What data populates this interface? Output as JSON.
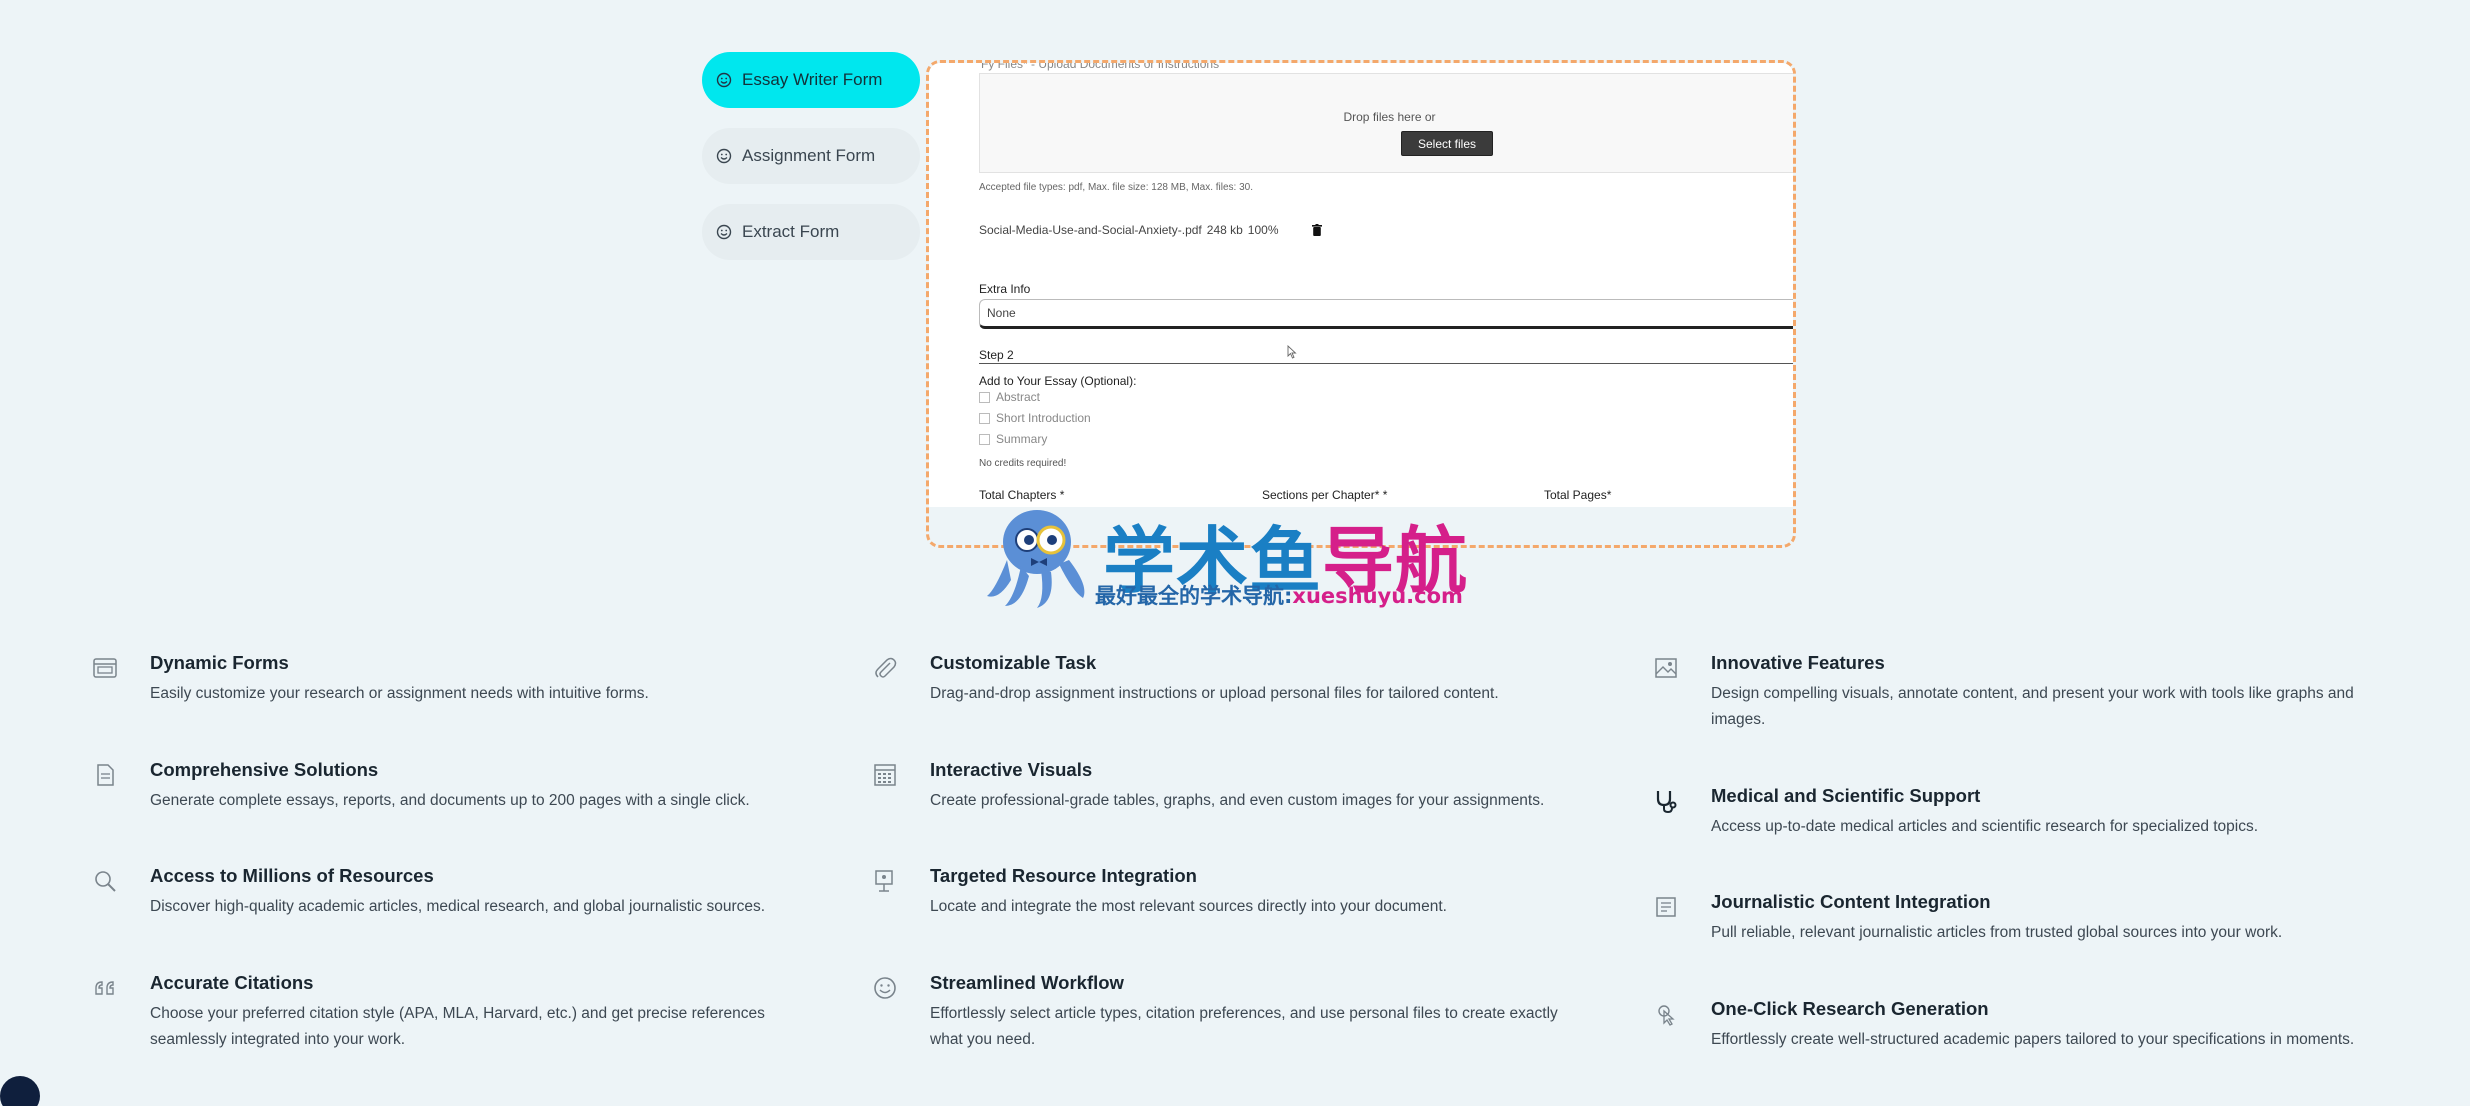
{
  "tabs": [
    {
      "label": "Essay Writer Form",
      "active": true
    },
    {
      "label": "Assignment Form",
      "active": false
    },
    {
      "label": "Extract Form",
      "active": false
    }
  ],
  "form": {
    "cut_label": "Fy Files* - Upload Documents or Instructions",
    "drop_text": "Drop files here or",
    "select_button": "Select files",
    "accepted": "Accepted file types: pdf, Max. file size: 128 MB, Max. files: 30.",
    "file": {
      "name": "Social-Media-Use-and-Social-Anxiety-.pdf",
      "size": "248 kb",
      "progress": "100%"
    },
    "extra_label": "Extra Info",
    "extra_value": "None",
    "step2": "Step 2",
    "add_label": "Add to Your Essay (Optional):",
    "options": [
      "Abstract",
      "Short Introduction",
      "Summary"
    ],
    "no_credits": "No credits required!",
    "total_chapters": "Total Chapters *",
    "sections_per_chapter": "Sections per Chapter* *",
    "total_pages": "Total Pages*"
  },
  "watermark": {
    "title_part1": "学术鱼",
    "title_part2": "导航",
    "sub_part1": "最好最全的学术导航:",
    "sub_part2": "xueshuyu.com"
  },
  "features": [
    {
      "icon": "form-icon",
      "title": "Dynamic Forms",
      "desc": "Easily customize your research or assignment needs with intuitive forms."
    },
    {
      "icon": "paperclip-icon",
      "title": "Customizable Task",
      "desc": "Drag-and-drop assignment instructions or upload personal files for tailored content."
    },
    {
      "icon": "image-icon",
      "title": "Innovative Features",
      "desc": "Design compelling visuals, annotate content, and present your work with tools like graphs and images."
    },
    {
      "icon": "document-icon",
      "title": "Comprehensive Solutions",
      "desc": "Generate complete essays, reports, and documents up to 200 pages with a single click."
    },
    {
      "icon": "calculator-icon",
      "title": "Interactive Visuals",
      "desc": "Create professional-grade tables, graphs, and even custom images for your assignments."
    },
    {
      "icon": "stethoscope-icon",
      "title": "Medical and Scientific Support",
      "desc": "Access up-to-date medical articles and scientific research for specialized topics."
    },
    {
      "icon": "search-icon",
      "title": "Access to Millions of Resources",
      "desc": "Discover high-quality academic articles, medical research, and global journalistic sources."
    },
    {
      "icon": "presentation-icon",
      "title": "Targeted Resource Integration",
      "desc": "Locate and integrate the most relevant sources directly into your document."
    },
    {
      "icon": "newspaper-icon",
      "title": "Journalistic Content Integration",
      "desc": "Pull reliable, relevant journalistic articles from trusted global sources into your work."
    },
    {
      "icon": "quote-icon",
      "title": "Accurate Citations",
      "desc": "Choose your preferred citation style (APA, MLA, Harvard, etc.) and get precise references seamlessly integrated into your work."
    },
    {
      "icon": "smile-icon",
      "title": "Streamlined Workflow",
      "desc": "Effortlessly select article types, citation preferences, and use personal files to create exactly what you need."
    },
    {
      "icon": "click-icon",
      "title": "One-Click Research Generation",
      "desc": "Effortlessly create well-structured academic papers tailored to your specifications in moments."
    }
  ]
}
